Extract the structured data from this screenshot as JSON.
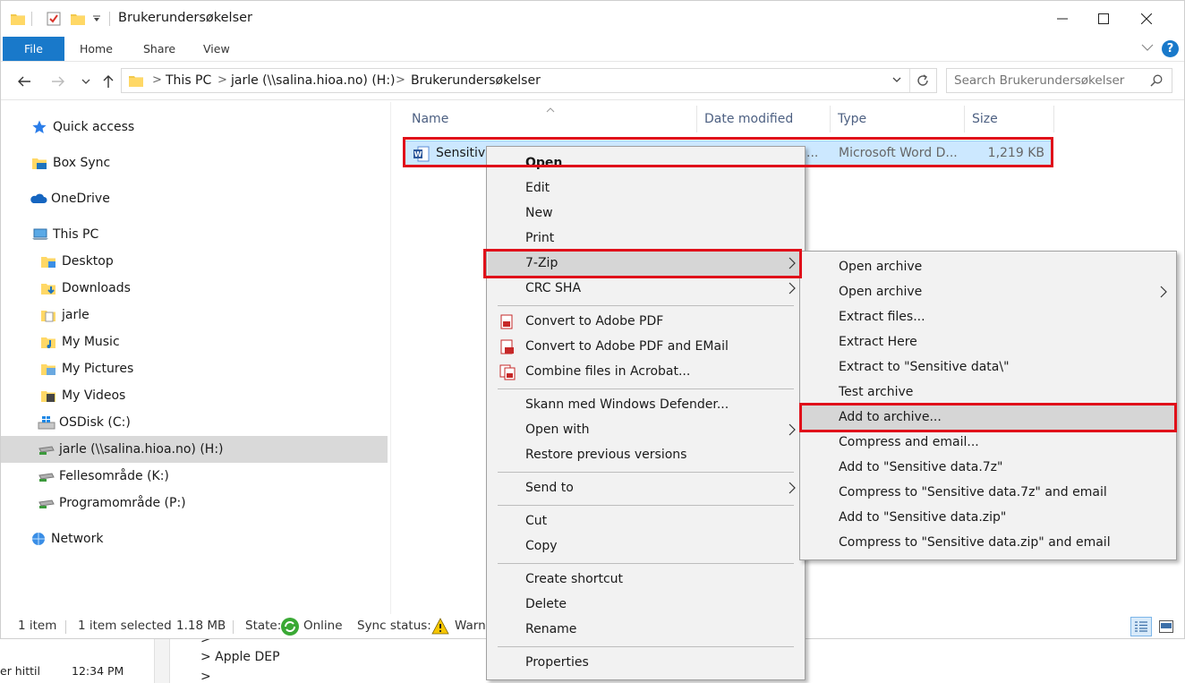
{
  "window": {
    "title": "Brukerundersøkelser"
  },
  "ribbon": {
    "tabs": [
      "File",
      "Home",
      "Share",
      "View"
    ],
    "help_label": "?"
  },
  "address": {
    "crumbs": [
      "This PC",
      "jarle (\\\\salina.hioa.no) (H:)",
      "Brukerundersøkelser"
    ],
    "search_placeholder": "Search Brukerundersøkelser"
  },
  "nav_pane": {
    "items": [
      {
        "label": "Quick access",
        "icon": "star-icon"
      },
      {
        "label": "Box Sync",
        "icon": "box-sync-folder-icon"
      },
      {
        "label": "OneDrive",
        "icon": "cloud-icon"
      },
      {
        "label": "This PC",
        "icon": "computer-icon"
      },
      {
        "label": "Desktop",
        "icon": "desktop-folder-icon"
      },
      {
        "label": "Downloads",
        "icon": "downloads-folder-icon"
      },
      {
        "label": "jarle",
        "icon": "user-folder-icon"
      },
      {
        "label": "My Music",
        "icon": "music-folder-icon"
      },
      {
        "label": "My Pictures",
        "icon": "pictures-folder-icon"
      },
      {
        "label": "My Videos",
        "icon": "videos-folder-icon"
      },
      {
        "label": "OSDisk (C:)",
        "icon": "windows-drive-icon"
      },
      {
        "label": "jarle (\\\\salina.hioa.no) (H:)",
        "icon": "network-drive-icon"
      },
      {
        "label": "Fellesområde (K:)",
        "icon": "network-drive-icon"
      },
      {
        "label": "Programområde (P:)",
        "icon": "network-drive-icon"
      },
      {
        "label": "Network",
        "icon": "network-icon"
      }
    ]
  },
  "columns": [
    "Name",
    "Date modified",
    "Type",
    "Size"
  ],
  "file": {
    "name": "Sensitive",
    "date_partial": "...",
    "type": "Microsoft Word D...",
    "size": "1,219 KB"
  },
  "status": {
    "count": "1 item",
    "selected": "1 item selected",
    "size": "1.18 MB",
    "state_label": "State:",
    "state_value": "Online",
    "sync_label": "Sync status:",
    "sync_value": "Warni"
  },
  "context_menu": {
    "items": [
      "Open",
      "Edit",
      "New",
      "Print",
      "7-Zip",
      "CRC SHA",
      "Convert to Adobe PDF",
      "Convert to Adobe PDF and EMail",
      "Combine files in Acrobat...",
      "Skann med Windows Defender...",
      "Open with",
      "Restore previous versions",
      "Send to",
      "Cut",
      "Copy",
      "Create shortcut",
      "Delete",
      "Rename",
      "Properties"
    ]
  },
  "zip_menu": {
    "items": [
      "Open archive",
      "Open archive",
      "Extract files...",
      "Extract Here",
      "Extract to \"Sensitive data\\\"",
      "Test archive",
      "Add to archive...",
      "Compress and email...",
      "Add to \"Sensitive data.7z\"",
      "Compress to \"Sensitive data.7z\" and email",
      "Add to \"Sensitive data.zip\"",
      "Compress to \"Sensitive data.zip\" and email"
    ]
  },
  "background_app": {
    "row_text": "er hittil",
    "time": "12:34 PM",
    "line1": ">",
    "line2": "> Apple DEP",
    "line3": ">"
  },
  "colors": {
    "accent": "#1979ca",
    "selection": "#cce8ff",
    "highlight_box": "#e0101a"
  }
}
